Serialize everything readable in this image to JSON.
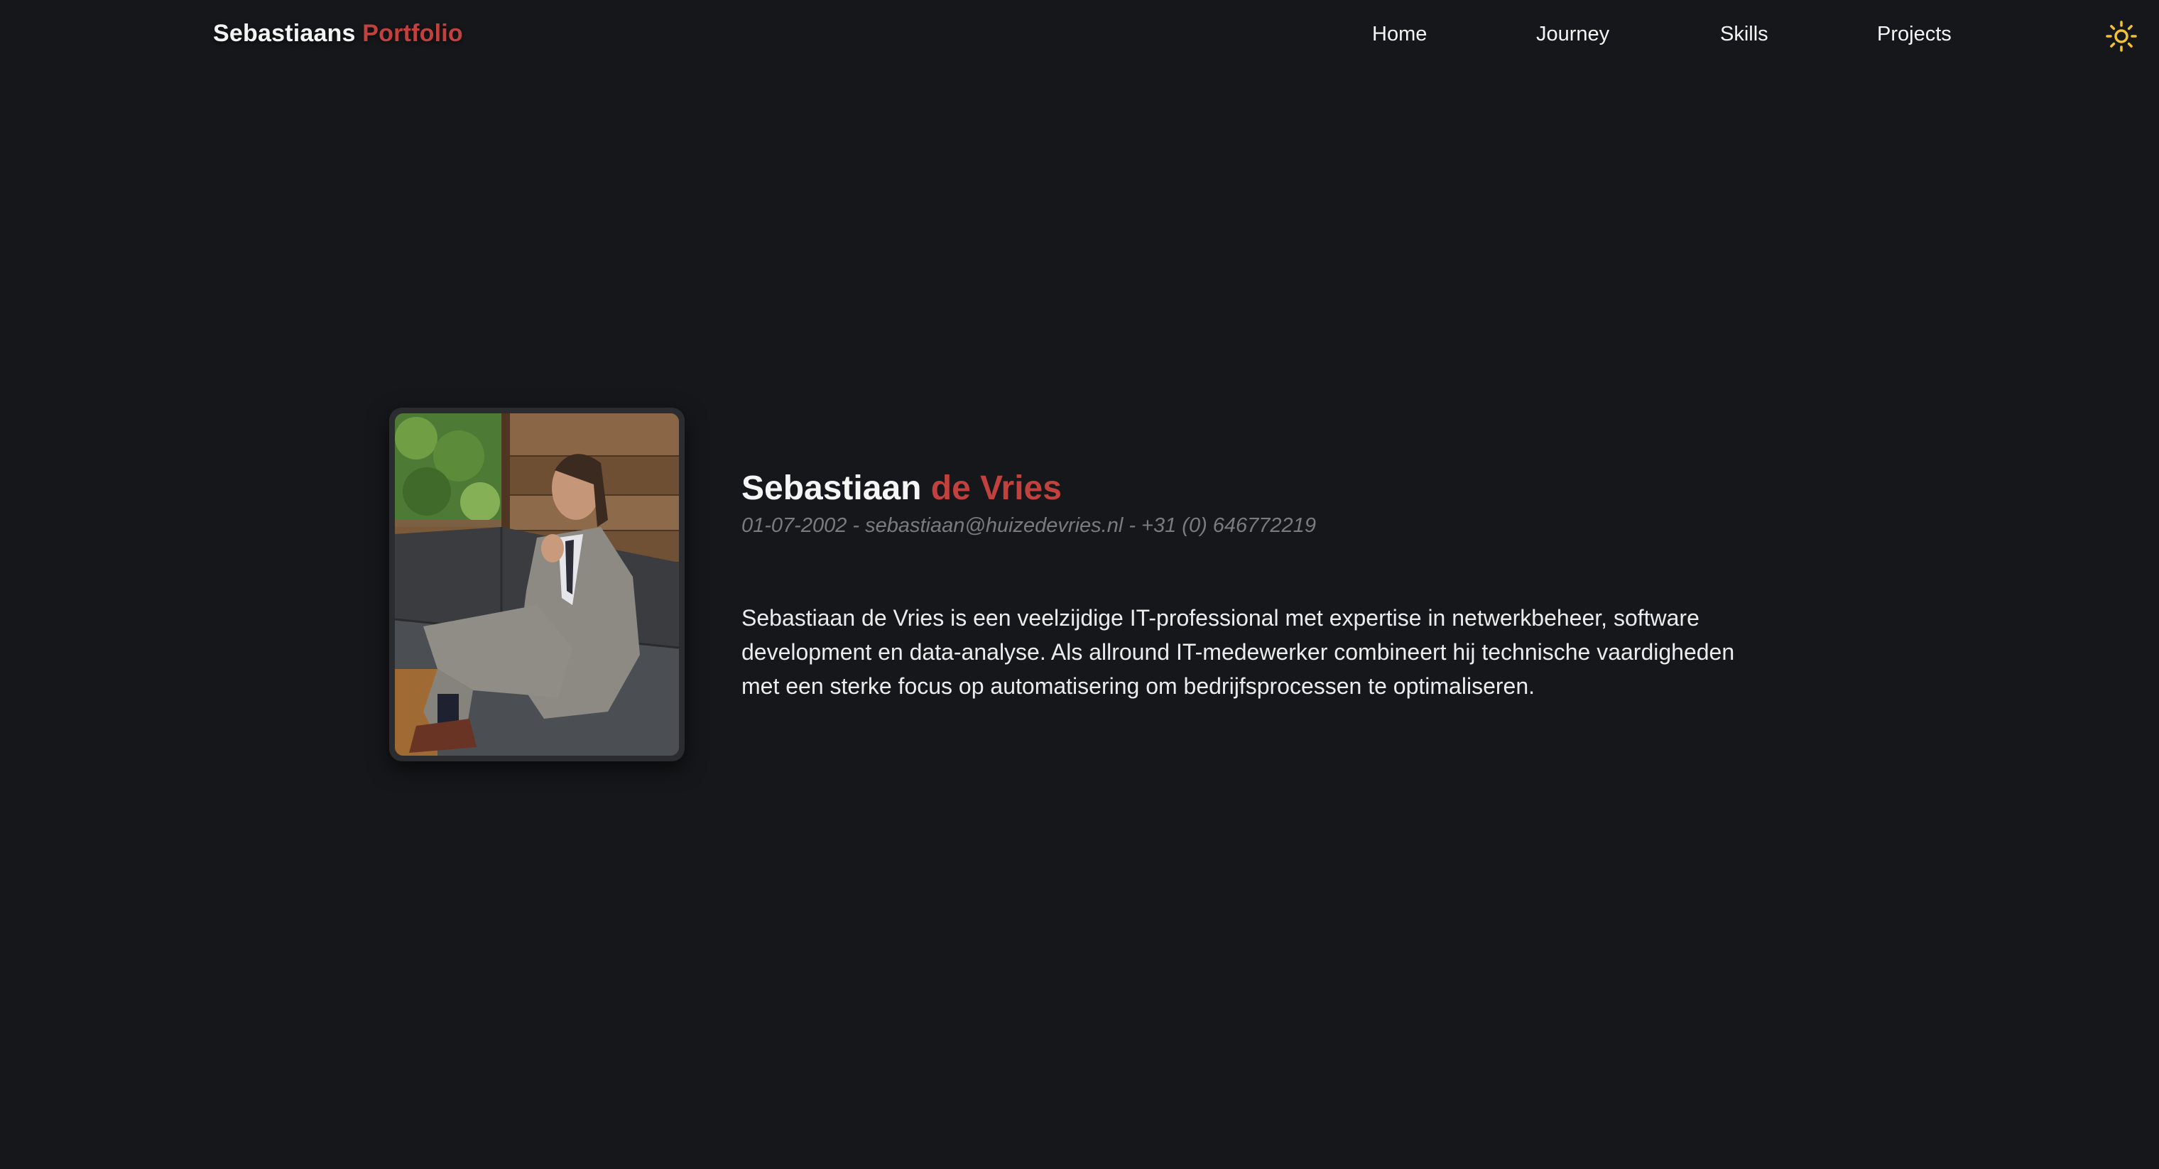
{
  "brand": {
    "first": "Sebastiaans",
    "second": "Portfolio"
  },
  "nav": {
    "items": [
      {
        "label": "Home"
      },
      {
        "label": "Journey"
      },
      {
        "label": "Skills"
      },
      {
        "label": "Projects"
      }
    ],
    "theme_toggle_icon": "sun-icon"
  },
  "profile": {
    "first_name": "Sebastiaan",
    "last_name": "de Vries",
    "contact": "01-07-2002 - sebastiaan@huizedevries.nl - +31 (0) 646772219",
    "bio": "Sebastiaan de Vries is een veelzijdige IT-professional met expertise in netwerkbeheer, software development en data-analyse. Als allround IT-medewerker combineert hij technische vaardigheden met een sterke focus op automatisering om bedrijfsprocessen te optimaliseren."
  },
  "colors": {
    "background": "#16171a",
    "accent": "#c0413e",
    "sun": "#f2c230",
    "muted_text": "#7a7b80"
  }
}
